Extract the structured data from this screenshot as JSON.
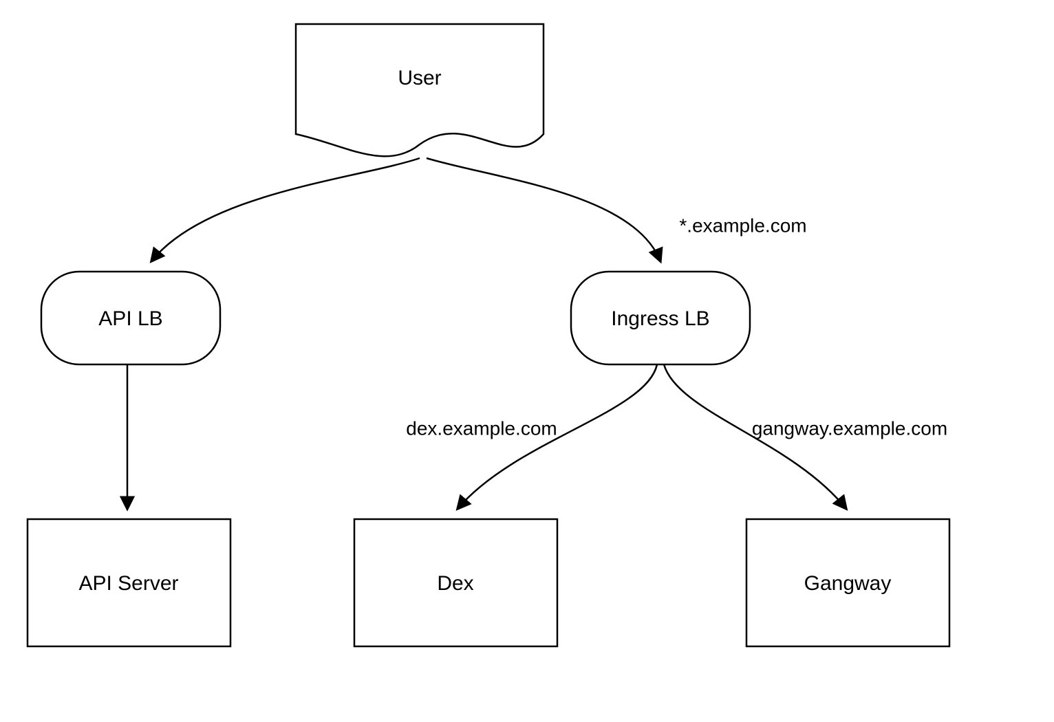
{
  "nodes": {
    "user": {
      "label": "User"
    },
    "api_lb": {
      "label": "API LB"
    },
    "ingress_lb": {
      "label": "Ingress LB"
    },
    "api_server": {
      "label": "API Server"
    },
    "dex": {
      "label": "Dex"
    },
    "gangway": {
      "label": "Gangway"
    }
  },
  "edges": {
    "user_to_ingress": {
      "label": "*.example.com"
    },
    "ingress_to_dex": {
      "label": "dex.example.com"
    },
    "ingress_to_gangway": {
      "label": "gangway.example.com"
    }
  }
}
